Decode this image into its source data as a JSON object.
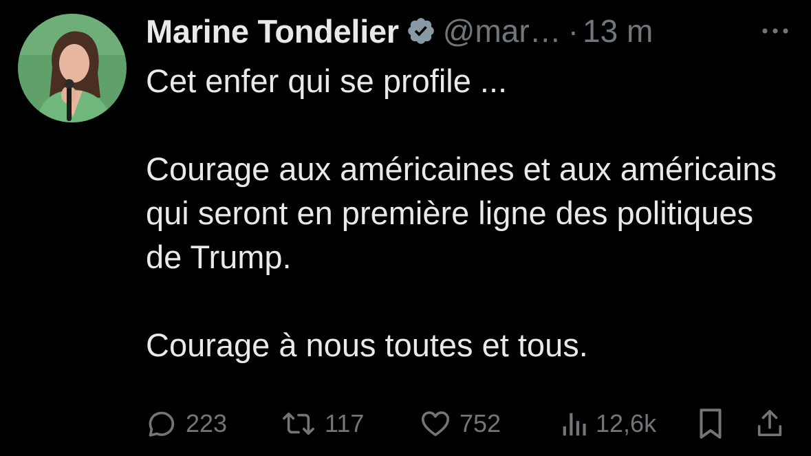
{
  "author": {
    "name": "Marine Tondelier",
    "handle": "@mar…",
    "separator": "·",
    "time": "13 m",
    "verified_color": "#8899a6"
  },
  "tweet": {
    "paragraphs": [
      "Cet enfer qui se profile ...",
      "Courage aux américaines et aux américains qui seront en première ligne des politiques de Trump.",
      "Courage à nous toutes et tous."
    ]
  },
  "actions": {
    "reply_count": "223",
    "retweet_count": "117",
    "like_count": "752",
    "views_count": "12,6k",
    "icons": [
      "reply-icon",
      "retweet-icon",
      "like-icon",
      "views-icon",
      "bookmark-icon",
      "share-icon"
    ]
  },
  "colors": {
    "background": "#000000",
    "text": "#e7e9ea",
    "muted": "#71767b"
  }
}
